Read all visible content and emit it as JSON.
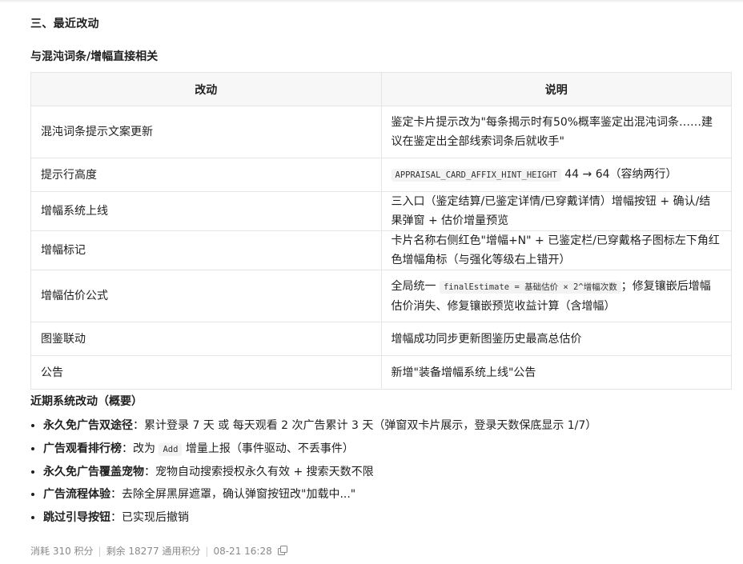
{
  "section_title": "三、最近改动",
  "subsection_title": "与混沌词条/增幅直接相关",
  "table": {
    "headers": [
      "改动",
      "说明"
    ],
    "rows": [
      {
        "change": "混沌词条提示文案更新",
        "desc": "鉴定卡片提示改为\"每条揭示时有50%概率鉴定出混沌词条……建议在鉴定出全部线索词条后就收手\""
      },
      {
        "change": "提示行高度",
        "code": "APPRAISAL_CARD_AFFIX_HINT_HEIGHT",
        "desc_after": " 44 → 64（容纳两行）"
      },
      {
        "change": "增幅系统上线",
        "desc": "三入口（鉴定结算/已鉴定详情/已穿戴详情）增幅按钮 + 确认/结果弹窗 + 估价增量预览"
      },
      {
        "change": "增幅标记",
        "desc": "卡片名称右侧红色\"增幅+N\" + 已鉴定栏/已穿戴格子图标左下角红色增幅角标（与强化等级右上错开）"
      },
      {
        "change": "增幅估价公式",
        "desc_before": "全局统一 ",
        "code": "finalEstimate = 基础估价 × 2^增幅次数",
        "desc_after": "；修复镶嵌后增幅估价消失、修复镶嵌预览收益计算（含增幅）"
      },
      {
        "change": "图鉴联动",
        "desc": "增幅成功同步更新图鉴历史最高总估价"
      },
      {
        "change": "公告",
        "desc": "新增\"装备增幅系统上线\"公告"
      }
    ]
  },
  "recent_title": "近期系统改动（概要）",
  "bullets": [
    {
      "bold": "永久免广告双途径",
      "text_before": "：累计登录 7 天 或 每天观看 2 次广告累计 3 天（弹窗双卡片展示，登录天数保底显示 1/7）"
    },
    {
      "bold": "广告观看排行榜",
      "text_before": "：改为 ",
      "code": "Add",
      "text_after": " 增量上报（事件驱动、不丢事件）"
    },
    {
      "bold": "永久免广告覆盖宠物",
      "text_before": "：宠物自动搜索授权永久有效 + 搜索天数不限"
    },
    {
      "bold": "广告流程体验",
      "text_before": "：去除全屏黑屏遮罩，确认弹窗按钮改\"加载中...\""
    },
    {
      "bold": "跳过引导按钮",
      "text_before": "：已实现后撤销"
    }
  ],
  "footer": {
    "cost": "消耗 310 积分",
    "remaining": "剩余 18277 通用积分",
    "time": "08-21 16:28",
    "copy_icon": "copy-icon"
  }
}
